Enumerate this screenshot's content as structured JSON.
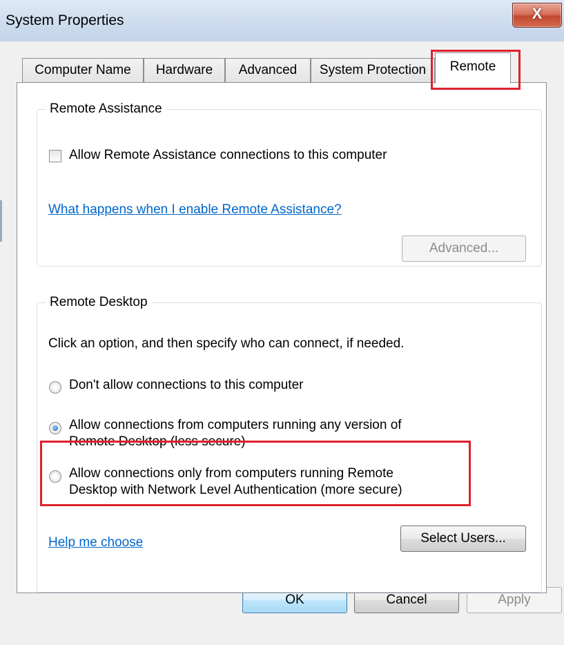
{
  "window": {
    "title": "System Properties",
    "close_glyph": "X"
  },
  "tabs": [
    {
      "label": "Computer Name"
    },
    {
      "label": "Hardware"
    },
    {
      "label": "Advanced"
    },
    {
      "label": "System Protection"
    },
    {
      "label": "Remote",
      "selected": true
    }
  ],
  "remote_assistance": {
    "legend": "Remote Assistance",
    "checkbox_label": "Allow Remote Assistance connections to this computer",
    "checked": false,
    "help_link": "What happens when I enable Remote Assistance?",
    "advanced_button": "Advanced..."
  },
  "remote_desktop": {
    "legend": "Remote Desktop",
    "instruction": "Click an option, and then specify who can connect, if needed.",
    "options": [
      {
        "line1": "Don't allow connections to this computer",
        "line2": "",
        "selected": false
      },
      {
        "line1": "Allow connections from computers running any version of",
        "line2": "Remote Desktop (less secure)",
        "selected": true
      },
      {
        "line1": "Allow connections only from computers running Remote",
        "line2": "Desktop with Network Level Authentication (more secure)",
        "selected": false
      }
    ],
    "help_link": "Help me choose",
    "select_users_button": "Select Users..."
  },
  "footer": {
    "ok": "OK",
    "cancel": "Cancel",
    "apply": "Apply"
  },
  "colors": {
    "highlight": "#e0202c",
    "link": "#0066cc"
  }
}
